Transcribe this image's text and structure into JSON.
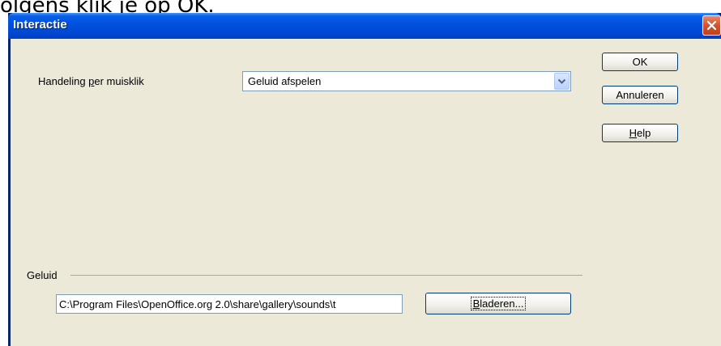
{
  "background_text": "olgens klik je op OK.",
  "window": {
    "title": "Interactie"
  },
  "action": {
    "label_pre": "Handeling ",
    "label_key": "p",
    "label_post": "er muisklik",
    "selected": "Geluid afspelen"
  },
  "buttons": {
    "ok": "OK",
    "cancel": "Annuleren",
    "help_key": "H",
    "help_rest": "elp",
    "browse_key": "B",
    "browse_rest": "laderen..."
  },
  "sound_group": {
    "label": "Geluid",
    "path": "C:\\Program Files\\OpenOffice.org 2.0\\share\\gallery\\sounds\\t"
  },
  "colors": {
    "titlebar": "#0052df",
    "dialog_bg": "#ece9d8",
    "button_border": "#003c74",
    "close_red": "#d4522d"
  }
}
